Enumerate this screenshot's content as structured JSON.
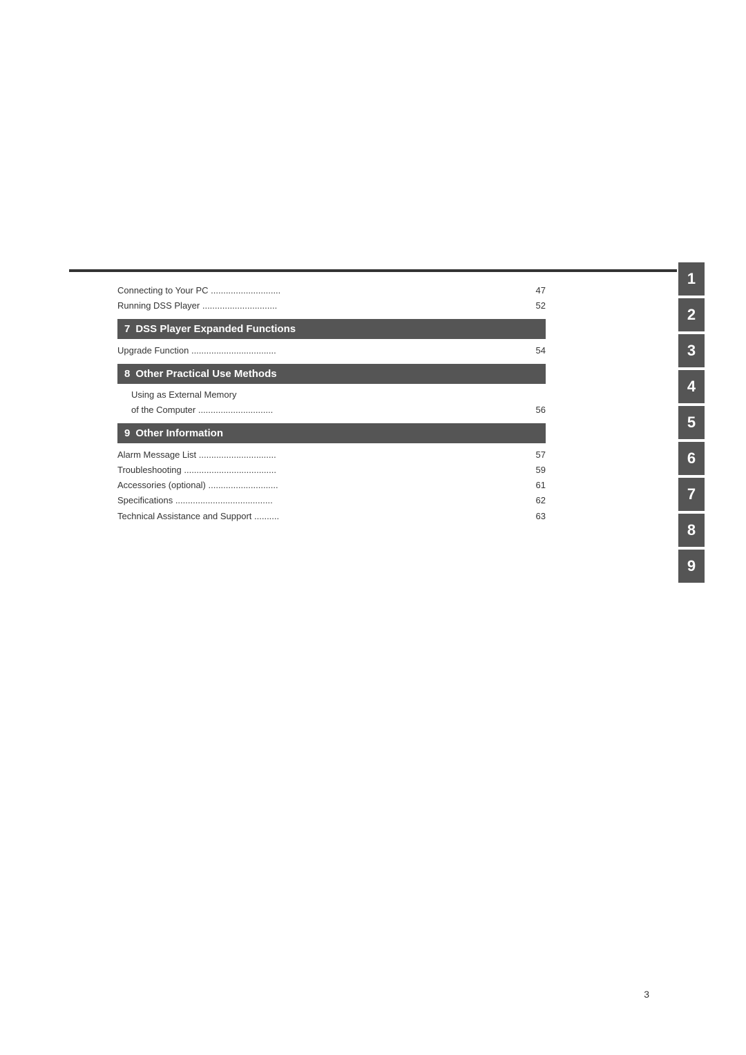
{
  "page": {
    "background": "#ffffff",
    "page_number": "3"
  },
  "top_rule": {
    "visible": true
  },
  "toc_entries_before_sections": [
    {
      "text": "Connecting to Your PC ............................",
      "page": "47"
    },
    {
      "text": "Running DSS Player ..............................",
      "page": "52"
    }
  ],
  "sections": [
    {
      "number": "7",
      "title": "DSS Player Expanded Functions",
      "entries": [
        {
          "text": "Upgrade Function ..................................",
          "page": "54"
        }
      ]
    },
    {
      "number": "8",
      "title": "Other Practical Use Methods",
      "entries": [
        {
          "text": "Using as External Memory",
          "sub_text": "of the Computer ..............................",
          "page": "56"
        }
      ]
    },
    {
      "number": "9",
      "title": "Other Information",
      "entries": [
        {
          "text": "Alarm Message List ...............................",
          "page": "57"
        },
        {
          "text": "Troubleshooting .....................................",
          "page": "59"
        },
        {
          "text": "Accessories (optional) ............................",
          "page": "61"
        },
        {
          "text": "Specifications  .......................................",
          "page": "62"
        },
        {
          "text": "Technical Assistance and Support ..........",
          "page": "63"
        }
      ]
    }
  ],
  "right_tabs": {
    "items": [
      {
        "number": "1"
      },
      {
        "number": "2"
      },
      {
        "number": "3"
      },
      {
        "number": "4"
      },
      {
        "number": "5"
      },
      {
        "number": "6"
      },
      {
        "number": "7"
      },
      {
        "number": "8"
      },
      {
        "number": "9"
      }
    ]
  }
}
